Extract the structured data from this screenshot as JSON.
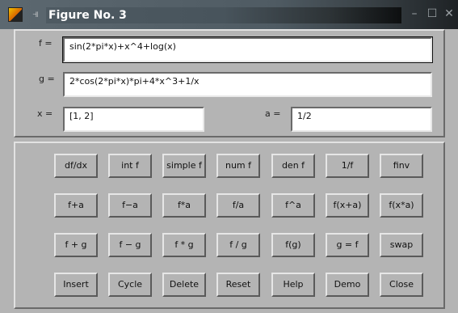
{
  "window": {
    "title": "Figure No. 3"
  },
  "fields": {
    "f": {
      "label": "f =",
      "value": "sin(2*pi*x)+x^4+log(x)"
    },
    "g": {
      "label": "g =",
      "value": "2*cos(2*pi*x)*pi+4*x^3+1/x"
    },
    "x": {
      "label": "x =",
      "value": "[1, 2]"
    },
    "a": {
      "label": "a =",
      "value": "1/2"
    }
  },
  "buttons": [
    [
      "df/dx",
      "int f",
      "simple f",
      "num f",
      "den f",
      "1/f",
      "finv"
    ],
    [
      "f+a",
      "f−a",
      "f*a",
      "f/a",
      "f^a",
      "f(x+a)",
      "f(x*a)"
    ],
    [
      "f + g",
      "f − g",
      "f * g",
      "f / g",
      "f(g)",
      "g = f",
      "swap"
    ],
    [
      "Insert",
      "Cycle",
      "Delete",
      "Reset",
      "Help",
      "Demo",
      "Close"
    ]
  ],
  "icons": {
    "app": "matlab-icon",
    "pin": "pin-icon",
    "minimize": "minimize-icon",
    "maximize": "maximize-icon",
    "close": "close-icon"
  }
}
